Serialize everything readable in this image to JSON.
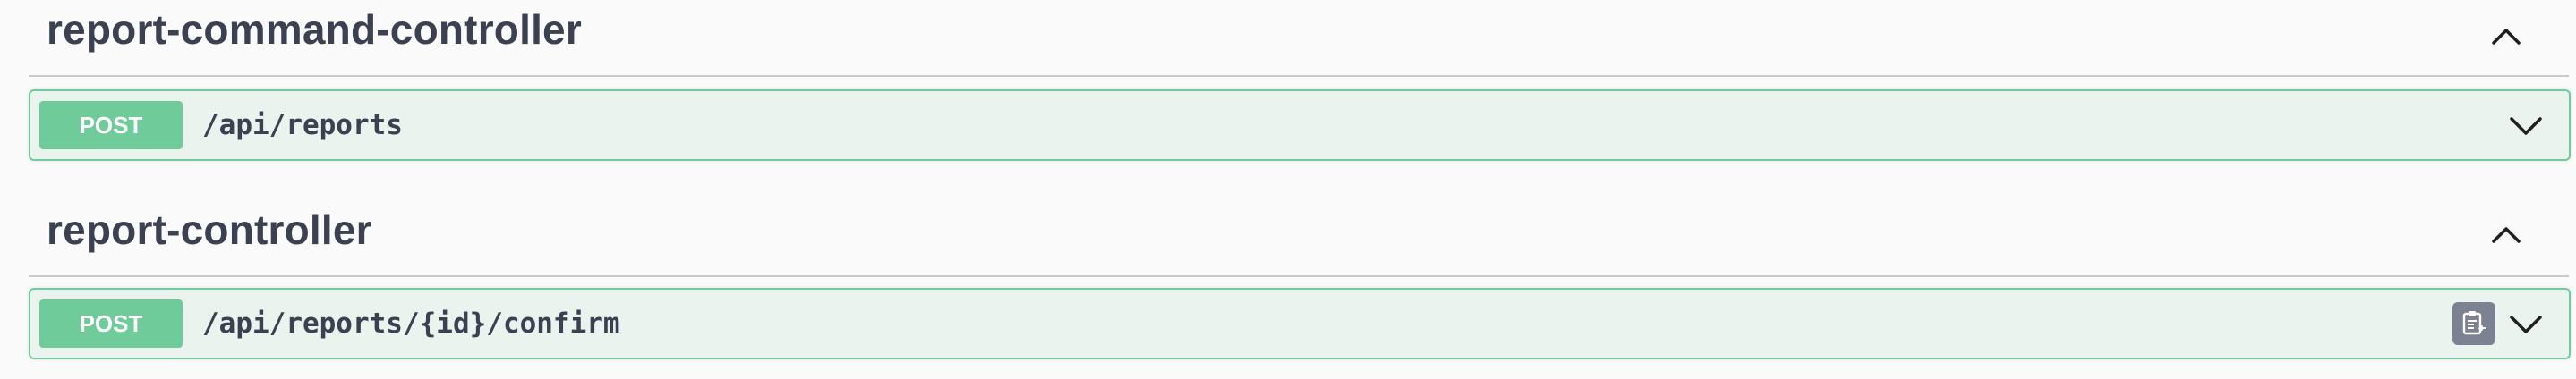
{
  "sections": [
    {
      "title": "report-command-controller",
      "operations": [
        {
          "method": "POST",
          "path": "/api/reports"
        }
      ]
    },
    {
      "title": "report-controller",
      "operations": [
        {
          "method": "POST",
          "path": "/api/reports/{id}/confirm"
        }
      ]
    }
  ],
  "colors": {
    "post_badge": "#6fcc9a",
    "post_border": "#6fcb9b",
    "post_background": "#ebf3ee",
    "title_text": "#3b4151",
    "copy_button": "#7d8293"
  },
  "icons": {
    "collapse": "chevron-up-icon",
    "expand": "chevron-down-icon",
    "copy": "clipboard-icon"
  }
}
